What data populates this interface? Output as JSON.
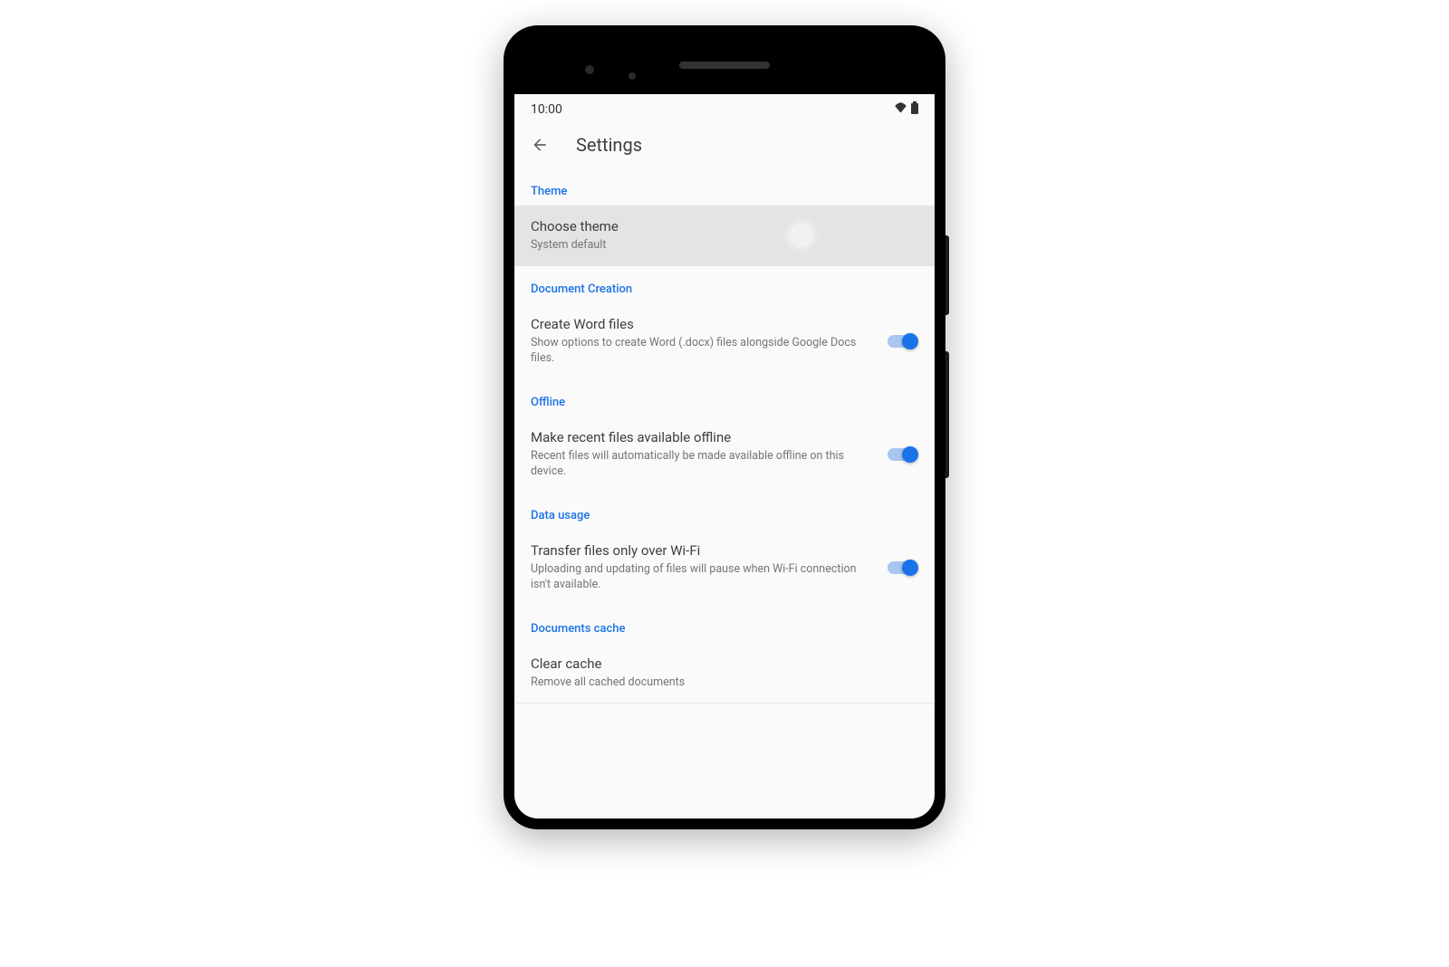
{
  "statusBar": {
    "time": "10:00"
  },
  "appBar": {
    "title": "Settings"
  },
  "sections": {
    "theme": {
      "header": "Theme",
      "chooseTheme": {
        "title": "Choose theme",
        "subtitle": "System default"
      }
    },
    "documentCreation": {
      "header": "Document Creation",
      "createWordFiles": {
        "title": "Create Word files",
        "subtitle": "Show options to create Word (.docx) files alongside Google Docs files.",
        "enabled": true
      }
    },
    "offline": {
      "header": "Offline",
      "makeRecentOffline": {
        "title": "Make recent files available offline",
        "subtitle": "Recent files will automatically be made available offline on this device.",
        "enabled": true
      }
    },
    "dataUsage": {
      "header": "Data usage",
      "transferWifiOnly": {
        "title": "Transfer files only over Wi-Fi",
        "subtitle": "Uploading and updating of files will pause when Wi-Fi connection isn't available.",
        "enabled": true
      }
    },
    "documentsCache": {
      "header": "Documents cache",
      "clearCache": {
        "title": "Clear cache",
        "subtitle": "Remove all cached documents"
      }
    }
  }
}
